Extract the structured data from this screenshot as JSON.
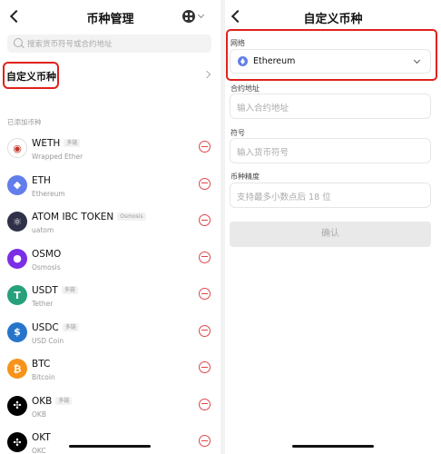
{
  "left": {
    "title": "币种管理",
    "search_placeholder": "搜索货币符号或合约地址",
    "custom_token_label": "自定义币种",
    "section_label": "已添加币种",
    "tokens": [
      {
        "symbol": "WETH",
        "name": "Wrapped Ether",
        "badge": "多链",
        "icon": "weth-icon",
        "color": "#ffffff",
        "glyph": "◉"
      },
      {
        "symbol": "ETH",
        "name": "Ethereum",
        "badge": "",
        "icon": "eth-icon",
        "color": "#627eea",
        "glyph": "◆"
      },
      {
        "symbol": "ATOM IBC TOKEN",
        "name": "uatom",
        "badge": "Osmosis",
        "icon": "atom-icon",
        "color": "#2e3148",
        "glyph": "⚛"
      },
      {
        "symbol": "OSMO",
        "name": "Osmosis",
        "badge": "",
        "icon": "osmo-icon",
        "color": "#7a2ee6",
        "glyph": "●"
      },
      {
        "symbol": "USDT",
        "name": "Tether",
        "badge": "多链",
        "icon": "usdt-icon",
        "color": "#26a17b",
        "glyph": "T"
      },
      {
        "symbol": "USDC",
        "name": "USD Coin",
        "badge": "多链",
        "icon": "usdc-icon",
        "color": "#2775ca",
        "glyph": "$"
      },
      {
        "symbol": "BTC",
        "name": "Bitcoin",
        "badge": "",
        "icon": "btc-icon",
        "color": "#f7931a",
        "glyph": "₿"
      },
      {
        "symbol": "OKB",
        "name": "OKB",
        "badge": "多链",
        "icon": "okb-icon",
        "color": "#000000",
        "glyph": "✣"
      },
      {
        "symbol": "OKT",
        "name": "OKC",
        "badge": "",
        "icon": "okt-icon",
        "color": "#000000",
        "glyph": "✣"
      }
    ]
  },
  "right": {
    "title": "自定义币种",
    "network_label": "网络",
    "network_value": "Ethereum",
    "contract_label": "合约地址",
    "contract_placeholder": "输入合约地址",
    "symbol_label": "符号",
    "symbol_placeholder": "输入货币符号",
    "decimals_label": "币种精度",
    "decimals_placeholder": "支持最多小数点后 18 位",
    "confirm_label": "确认"
  },
  "colors": {
    "highlight": "#e0211c",
    "remove": "#e0454a"
  }
}
